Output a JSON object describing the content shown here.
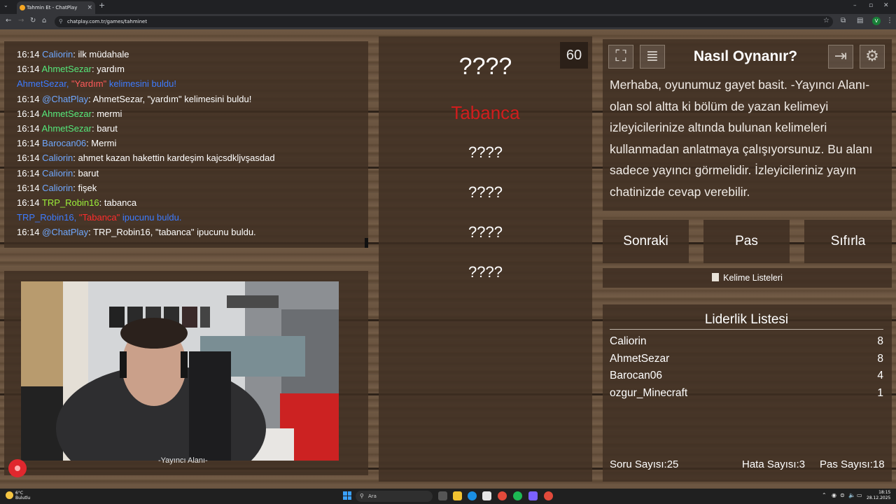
{
  "browser": {
    "tab_title": "Tahmin Et - ChatPlay",
    "tab_close": "×",
    "new_tab": "+",
    "url": "chatplay.com.tr/games/tahminet"
  },
  "chat": {
    "lines": [
      {
        "time": "16:14",
        "user": "Caliorin",
        "msg": ": ilk müdahale"
      },
      {
        "time": "16:14",
        "user": "AhmetSezar",
        "msg": ": yardım"
      },
      {
        "sys1_a": "AhmetSezar, ",
        "sys1_b": "\"Yardım\"",
        "sys1_c": " kelimesini buldu!"
      },
      {
        "time": "16:14",
        "user": "@ChatPlay",
        "msg": ": AhmetSezar, \"yardım\" kelimesini buldu!"
      },
      {
        "time": "16:14",
        "user": "AhmetSezar",
        "msg": ": mermi"
      },
      {
        "time": "16:14",
        "user": "AhmetSezar",
        "msg": ": barut"
      },
      {
        "time": "16:14",
        "user": "Barocan06",
        "msg": ": Mermi"
      },
      {
        "time": "16:14",
        "user": "Caliorin",
        "msg": ": ahmet kazan hakettin kardeşim kajcsdkljvşasdad"
      },
      {
        "time": "16:14",
        "user": "Caliorin",
        "msg": ": barut"
      },
      {
        "time": "16:14",
        "user": "Caliorin",
        "msg": ": fişek"
      },
      {
        "time": "16:14",
        "user": "TRP_Robin16",
        "msg": ": tabanca"
      },
      {
        "sys2_a": "TRP_Robin16, ",
        "sys2_b": "\"Tabanca\"",
        "sys2_c": " ipucunu buldu."
      },
      {
        "time": "16:14",
        "user": "@ChatPlay",
        "msg": ": TRP_Robin16, \"tabanca\" ipucunu buldu."
      }
    ]
  },
  "camera": {
    "label": "-Yayıncı Alanı-"
  },
  "words": {
    "timer": "60",
    "main": "????",
    "found": "Tabanca",
    "hidden": [
      "????",
      "????",
      "????",
      "????"
    ]
  },
  "info": {
    "title": "Nasıl Oynanır?",
    "lines": [
      "Merhaba, oyunumuz gayet basit. -Yayıncı Alanı-",
      "olan sol altta ki bölüm de yazan kelimeyi",
      "izleyicilerinize altında bulunan kelimeleri",
      "kullanmadan anlatmaya çalışıyorsunuz. Bu alanı",
      "sadece yayıncı görmelidir. İzleyicileriniz yayın",
      "chatinizde cevap verebilir."
    ]
  },
  "buttons": {
    "next": "Sonraki",
    "pass": "Pas",
    "reset": "Sıfırla",
    "word_lists": "Kelime Listeleri"
  },
  "leaderboard": {
    "title": "Liderlik Listesi",
    "rows": [
      {
        "name": "Caliorin",
        "score": "8"
      },
      {
        "name": "AhmetSezar",
        "score": "8"
      },
      {
        "name": "Barocan06",
        "score": "4"
      },
      {
        "name": "ozgur_Minecraft",
        "score": "1"
      }
    ],
    "question_count": "Soru Sayısı:25",
    "error_count": "Hata Sayısı:3",
    "pass_count": "Pas Sayısı:18"
  },
  "taskbar": {
    "temp": "6°C",
    "weather": "Bulutlu",
    "search": "Ara",
    "time": "18:15",
    "date": "28.12.2025"
  },
  "colors": {
    "user_blue": "#6fa8ff",
    "user_green": "#55e87a",
    "user_lime": "#9cf03a",
    "system_blue": "#3d7bff",
    "found_red": "#d01d1d"
  }
}
